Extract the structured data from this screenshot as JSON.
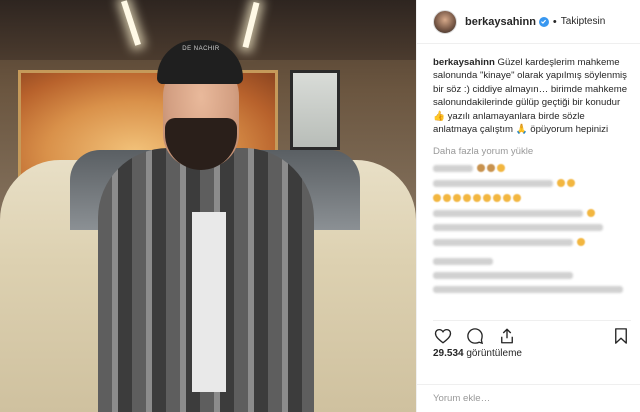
{
  "post": {
    "username": "berkaysahinn",
    "follow_status": "Takiptesin",
    "caption_user": "berkaysahinn",
    "caption_text": "Güzel kardeşlerim mahkeme salonunda \"kinaye\" olarak yapılmış söylenmiş bir söz :) ciddiye almayın… birimde mahkeme salonundakilerinde gülüp geçtiği bir konudur 👍 yazılı anlamayanlara birde sözle anlatmaya çalıştım 🙏 öpüyorum hepinizi",
    "load_more": "Daha fazla yorum yükle",
    "views_count": "29.534",
    "views_label": "görüntüleme",
    "comment_placeholder": "Yorum ekle…"
  },
  "video": {
    "cap_text": "DE NACHIR"
  },
  "colors": {
    "verified_blue": "#3897f0",
    "muted_text": "#999999",
    "border": "#efefef"
  },
  "icons": [
    "verified-badge-icon",
    "heart-icon",
    "comment-icon",
    "share-icon",
    "bookmark-icon"
  ]
}
